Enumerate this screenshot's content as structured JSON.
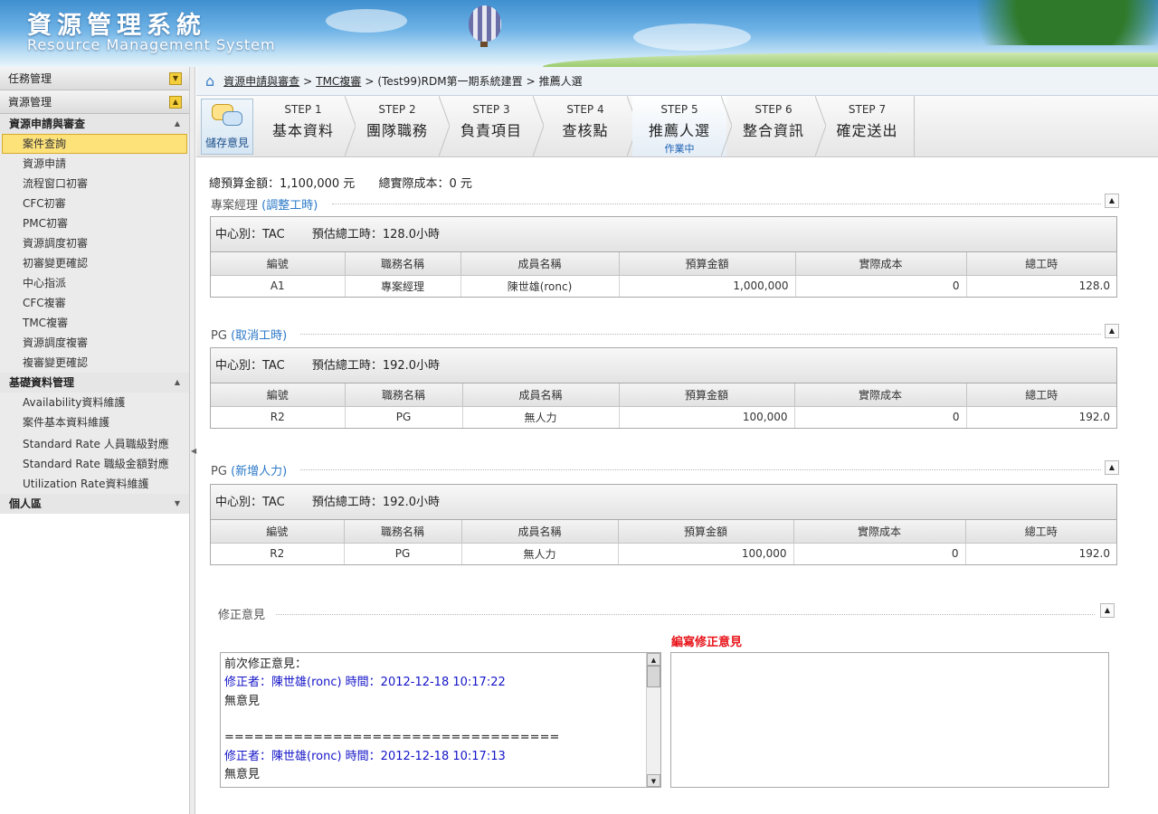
{
  "header": {
    "title_zh": "資源管理系統",
    "title_en": "Resource Management System"
  },
  "sidebar": {
    "top_sections": [
      {
        "label": "任務管理",
        "toggle": "down"
      },
      {
        "label": "資源管理",
        "toggle": "up"
      }
    ],
    "groups": [
      {
        "label": "資源申請與審查",
        "items": [
          "案件查詢",
          "資源申請",
          "流程窗口初審",
          "CFC初審",
          "PMC初審",
          "資源調度初審",
          "初審變更確認",
          "中心指派",
          "CFC複審",
          "TMC複審",
          "資源調度複審",
          "複審變更確認"
        ]
      },
      {
        "label": "基礎資料管理",
        "items": [
          "Availability資料維護",
          "案件基本資料維護",
          "Standard Rate 人員職級對應",
          "Standard Rate 職級金額對應",
          "Utilization Rate資料維護"
        ]
      },
      {
        "label": "個人區",
        "items": []
      }
    ],
    "active_item": "案件查詢"
  },
  "breadcrumb": {
    "link1": "資源申請與審查",
    "link2": "TMC複審",
    "text": "(Test99)RDM第一期系統建置",
    "current": "推薦人選"
  },
  "toolbar": {
    "save_label": "儲存意見"
  },
  "steps": [
    {
      "num": "STEP 1",
      "name": "基本資料",
      "state": ""
    },
    {
      "num": "STEP 2",
      "name": "團隊職務",
      "state": ""
    },
    {
      "num": "STEP 3",
      "name": "負責項目",
      "state": ""
    },
    {
      "num": "STEP 4",
      "name": "查核點",
      "state": ""
    },
    {
      "num": "STEP 5",
      "name": "推薦人選",
      "state": "作業中"
    },
    {
      "num": "STEP 6",
      "name": "整合資訊",
      "state": ""
    },
    {
      "num": "STEP 7",
      "name": "確定送出",
      "state": ""
    }
  ],
  "totals": {
    "budget": "總預算金額：1,100,000 元",
    "actual": "總實際成本：0 元"
  },
  "columns": [
    "編號",
    "職務名稱",
    "成員名稱",
    "預算金額",
    "實際成本",
    "總工時"
  ],
  "sections": [
    {
      "title": "專案經理",
      "paren": "(調整工時)",
      "center": "中心別：TAC",
      "hours": "預估總工時：128.0小時",
      "rows": [
        [
          "A1",
          "專案經理",
          "陳世雄(ronc)",
          "1,000,000",
          "0",
          "128.0"
        ]
      ]
    },
    {
      "title": "PG",
      "paren": "(取消工時)",
      "center": "中心別：TAC",
      "hours": "預估總工時：192.0小時",
      "rows": [
        [
          "R2",
          "PG",
          "無人力",
          "100,000",
          "0",
          "192.0"
        ]
      ]
    },
    {
      "title": "PG",
      "paren": "(新增人力)",
      "center": "中心別：TAC",
      "hours": "預估總工時：192.0小時",
      "rows": [
        [
          "R2",
          "PG",
          "無人力",
          "100,000",
          "0",
          "192.0"
        ]
      ]
    }
  ],
  "revision": {
    "title": "修正意見",
    "edit_label": "編寫修正意見",
    "history_heading": "前次修正意見：",
    "entries": [
      {
        "meta": "修正者：陳世雄(ronc)  時間：2012-12-18 10:17:22",
        "text": "無意見"
      },
      {
        "meta": "修正者：陳世雄(ronc)  時間：2012-12-18 10:17:13",
        "text": "無意見"
      }
    ],
    "divider": "=================================="
  },
  "colors": {
    "accent_blue": "#2a78c8",
    "active_item": "#fde27a",
    "edit_red": "#e8141a",
    "meta_blue": "#1515c8"
  }
}
